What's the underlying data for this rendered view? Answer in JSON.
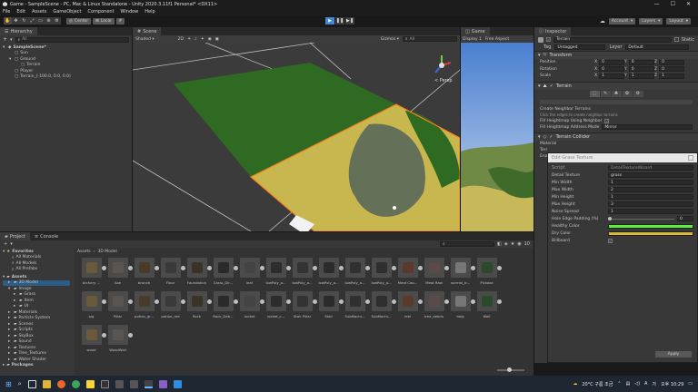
{
  "window": {
    "title": "Game - SampleScene - PC, Mac & Linux Standalone - Unity 2020.3.11f1 Personal* <DX11>",
    "controls": [
      "—",
      "☐",
      "✕"
    ]
  },
  "menu": [
    "File",
    "Edit",
    "Assets",
    "GameObject",
    "Component",
    "Window",
    "Help"
  ],
  "toolbar": {
    "pivot_label": "Center",
    "space_label": "Local",
    "account_label": "Account",
    "layers_label": "Layers",
    "layout_label": "Layout"
  },
  "hierarchy": {
    "tab": "Hierarchy",
    "search_placeholder": "All",
    "items": [
      {
        "label": "SampleScene*",
        "indent": 0
      },
      {
        "label": "Sun",
        "indent": 1
      },
      {
        "label": "Ground",
        "indent": 1
      },
      {
        "label": "Terrain",
        "indent": 2
      },
      {
        "label": "Player",
        "indent": 1
      },
      {
        "label": "Terrain_(-100.0, 0.0, 0.0)",
        "indent": 1
      }
    ]
  },
  "scene": {
    "tab": "Scene",
    "shading": "Shaded",
    "mode": "2D",
    "gizmos": "Gizmos",
    "search_placeholder": "All",
    "persp_label": "< Persp"
  },
  "game": {
    "tab": "Game",
    "display": "Display 1",
    "aspect": "Free Aspect"
  },
  "inspector": {
    "tab": "Inspector",
    "object_name": "Terrain",
    "static_label": "Static",
    "tag_label": "Tag",
    "tag_value": "Untagged",
    "layer_label": "Layer",
    "layer_value": "Default",
    "transform": {
      "title": "Transform",
      "rows": [
        {
          "label": "Position",
          "x": "0",
          "y": "0",
          "z": "0"
        },
        {
          "label": "Rotation",
          "x": "0",
          "y": "0",
          "z": "0"
        },
        {
          "label": "Scale",
          "x": "1",
          "y": "1",
          "z": "1"
        }
      ]
    },
    "terrain": {
      "title": "Terrain",
      "create_neighbor": "Create Neighbor Terrains",
      "hint": "Click the edges to create neighbor terrains",
      "fill_heightmap": "Fill Heightmap Using Neighbor",
      "fill_mode_label": "Fill Heightmap Address Mode",
      "fill_mode_value": "Mirror"
    },
    "collider": {
      "title": "Terrain Collider",
      "material_label": "Material",
      "terrain_data_label": "Terr",
      "enable_label": "Enab"
    },
    "popup_title": "Edit Grass Texture",
    "grass": {
      "script_label": "Script",
      "script_value": "DetailTextureWizard",
      "rows": [
        {
          "label": "Detail Texture",
          "value": "grass"
        },
        {
          "label": "Min Width",
          "value": "1"
        },
        {
          "label": "Max Width",
          "value": "2"
        },
        {
          "label": "Min Height",
          "value": "1"
        },
        {
          "label": "Max Height",
          "value": "3"
        },
        {
          "label": "Noise Spread",
          "value": "1"
        },
        {
          "label": "Hole Edge Padding (%)",
          "value": "0"
        },
        {
          "label": "Healthy Color",
          "value": ""
        },
        {
          "label": "Dry Color",
          "value": ""
        },
        {
          "label": "Billboard",
          "value": "✓"
        }
      ],
      "healthy_color": "#5cf03c",
      "dry_color": "#d9b83a",
      "apply_label": "Apply"
    }
  },
  "project": {
    "tabs": [
      "Project",
      "Console"
    ],
    "breadcrumb": [
      "Assets",
      "3D Model"
    ],
    "asset_count": "10",
    "favorites": {
      "label": "Favorites",
      "items": [
        "All Materials",
        "All Models",
        "All Prefabs"
      ]
    },
    "assets_root": "Assets",
    "tree": [
      {
        "label": "3D Model",
        "indent": 1,
        "selected": true
      },
      {
        "label": "Image",
        "indent": 1
      },
      {
        "label": "Grass",
        "indent": 2
      },
      {
        "label": "Item",
        "indent": 2
      },
      {
        "label": "UI",
        "indent": 2
      },
      {
        "label": "Materials",
        "indent": 1
      },
      {
        "label": "Particle System",
        "indent": 1
      },
      {
        "label": "Scenes",
        "indent": 1
      },
      {
        "label": "Scripts",
        "indent": 1
      },
      {
        "label": "SkyBox",
        "indent": 1
      },
      {
        "label": "Sound",
        "indent": 1
      },
      {
        "label": "Textures",
        "indent": 1
      },
      {
        "label": "Tree_Textures",
        "indent": 1
      },
      {
        "label": "Water Shader",
        "indent": 1
      }
    ],
    "packages": "Packages",
    "assets_row1": [
      "Archery ...",
      "Axe",
      "branch",
      "Floor",
      "Foundation",
      "Grass_Dir...",
      "leaf",
      "lowPoly_a...",
      "lowPoly_a...",
      "lowPoly_a...",
      "lowPoly_a...",
      "lowPoly_a...",
      "Meat Coo...",
      "Meat Raw",
      "normal_tr...",
      "Pickaxe"
    ],
    "assets_row2": [
      "pig",
      "Pillar",
      "potion_gr...",
      "potion_red",
      "Rock",
      "Rock_Deb...",
      "rocket",
      "rocket_c...",
      "Stair Pillar",
      "Stall",
      "SubMachi...",
      "SubMachi...",
      "reel",
      "tree_debris",
      "twig",
      "Wall"
    ],
    "assets_row3": [
      "wood",
      "WoodWall"
    ]
  },
  "taskbar": {
    "weather": "20°C 구름 조금",
    "lang": "A",
    "ime": "가",
    "time": "오후 10:29"
  }
}
